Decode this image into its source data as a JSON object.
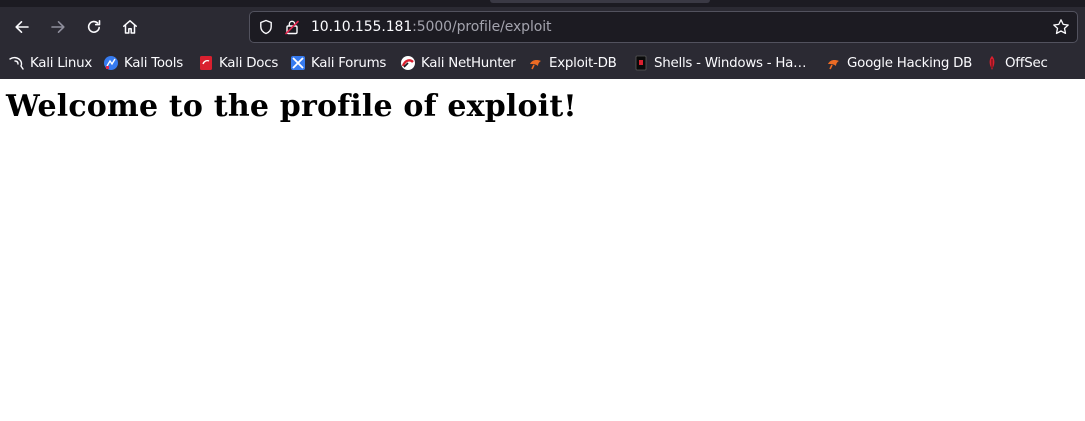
{
  "browser": {
    "url_host": "10.10.155.181",
    "url_rest": ":5000/profile/exploit",
    "nav_icons": [
      "back-arrow-icon",
      "forward-arrow-icon",
      "reload-icon",
      "home-icon"
    ],
    "urlbar_icons": [
      "tracking-shield-icon",
      "insecure-lock-icon",
      "bookmark-star-icon"
    ]
  },
  "bookmarks": [
    {
      "label": "Kali Linux",
      "icon": "kali-dragon-icon"
    },
    {
      "label": "Kali Tools",
      "icon": "kali-tools-icon"
    },
    {
      "label": "Kali Docs",
      "icon": "kali-docs-icon"
    },
    {
      "label": "Kali Forums",
      "icon": "kali-forums-icon"
    },
    {
      "label": "Kali NetHunter",
      "icon": "kali-nethunter-icon"
    },
    {
      "label": "Exploit-DB",
      "icon": "exploit-db-icon"
    },
    {
      "label": "Shells - Windows - Ha…",
      "icon": "shells-icon"
    },
    {
      "label": "Google Hacking DB",
      "icon": "ghdb-icon"
    },
    {
      "label": "OffSec",
      "icon": "offsec-icon"
    }
  ],
  "page": {
    "heading": "Welcome to the profile of exploit!"
  },
  "colors": {
    "chrome_bg": "#2b2a33",
    "urlbar_bg": "#1c1b22",
    "page_bg": "#ffffff",
    "heading": "#000000"
  }
}
